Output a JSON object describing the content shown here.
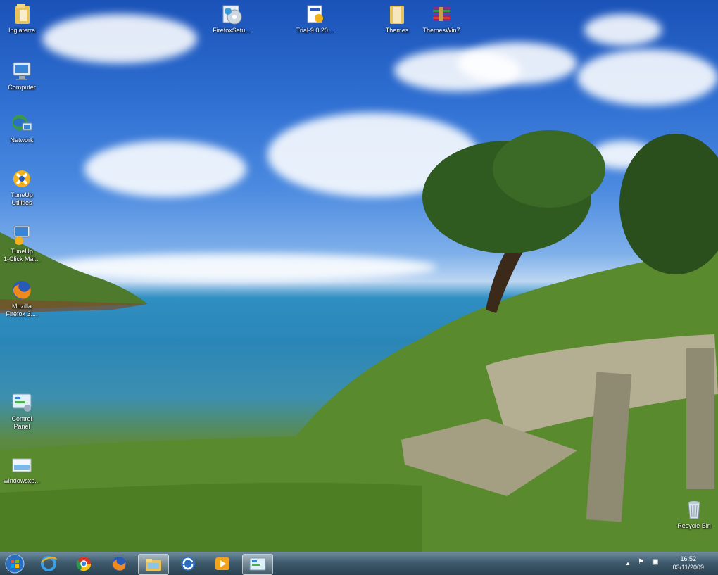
{
  "desktop": {
    "icons": [
      {
        "label": "Inglaterra",
        "icon": "folder-icon"
      },
      {
        "label": "Computer",
        "icon": "computer-icon"
      },
      {
        "label": "Network",
        "icon": "network-icon"
      },
      {
        "label": "TuneUp\nUtilities",
        "icon": "tuneup-icon"
      },
      {
        "label": "TuneUp\n1-Click Mai...",
        "icon": "tuneup-1click-icon"
      },
      {
        "label": "Mozilla\nFirefox 3....",
        "icon": "firefox-icon"
      },
      {
        "label": "Control\nPanel",
        "icon": "control-panel-icon"
      },
      {
        "label": "windowsxp...",
        "icon": "image-file-icon"
      },
      {
        "label": "FirefoxSetu...",
        "icon": "setup-disc-icon"
      },
      {
        "label": "Trial-9.0.20...",
        "icon": "installer-icon"
      },
      {
        "label": "Themes",
        "icon": "folder-icon"
      },
      {
        "label": "ThemesWin7",
        "icon": "archive-icon"
      },
      {
        "label": "Recycle Bin",
        "icon": "recycle-bin-icon"
      }
    ]
  },
  "taskbar": {
    "start_icon": "windows-orb-icon",
    "pinned": [
      {
        "icon": "internet-explorer-icon"
      },
      {
        "icon": "chrome-icon"
      },
      {
        "icon": "firefox-icon"
      },
      {
        "icon": "windows-explorer-icon"
      },
      {
        "icon": "update-icon"
      },
      {
        "icon": "media-player-icon"
      },
      {
        "icon": "control-panel-icon"
      }
    ],
    "tray": {
      "show_hidden_glyph": "▲",
      "flag_glyph": "⚑",
      "network_glyph": "▣"
    },
    "clock": {
      "time": "16:52",
      "date": "03/11/2009"
    }
  },
  "colors": {
    "sky": "#2f6fd2",
    "sea": "#2b86b8",
    "grass": "#5d8a42",
    "taskbar": "#3e5a6c"
  }
}
